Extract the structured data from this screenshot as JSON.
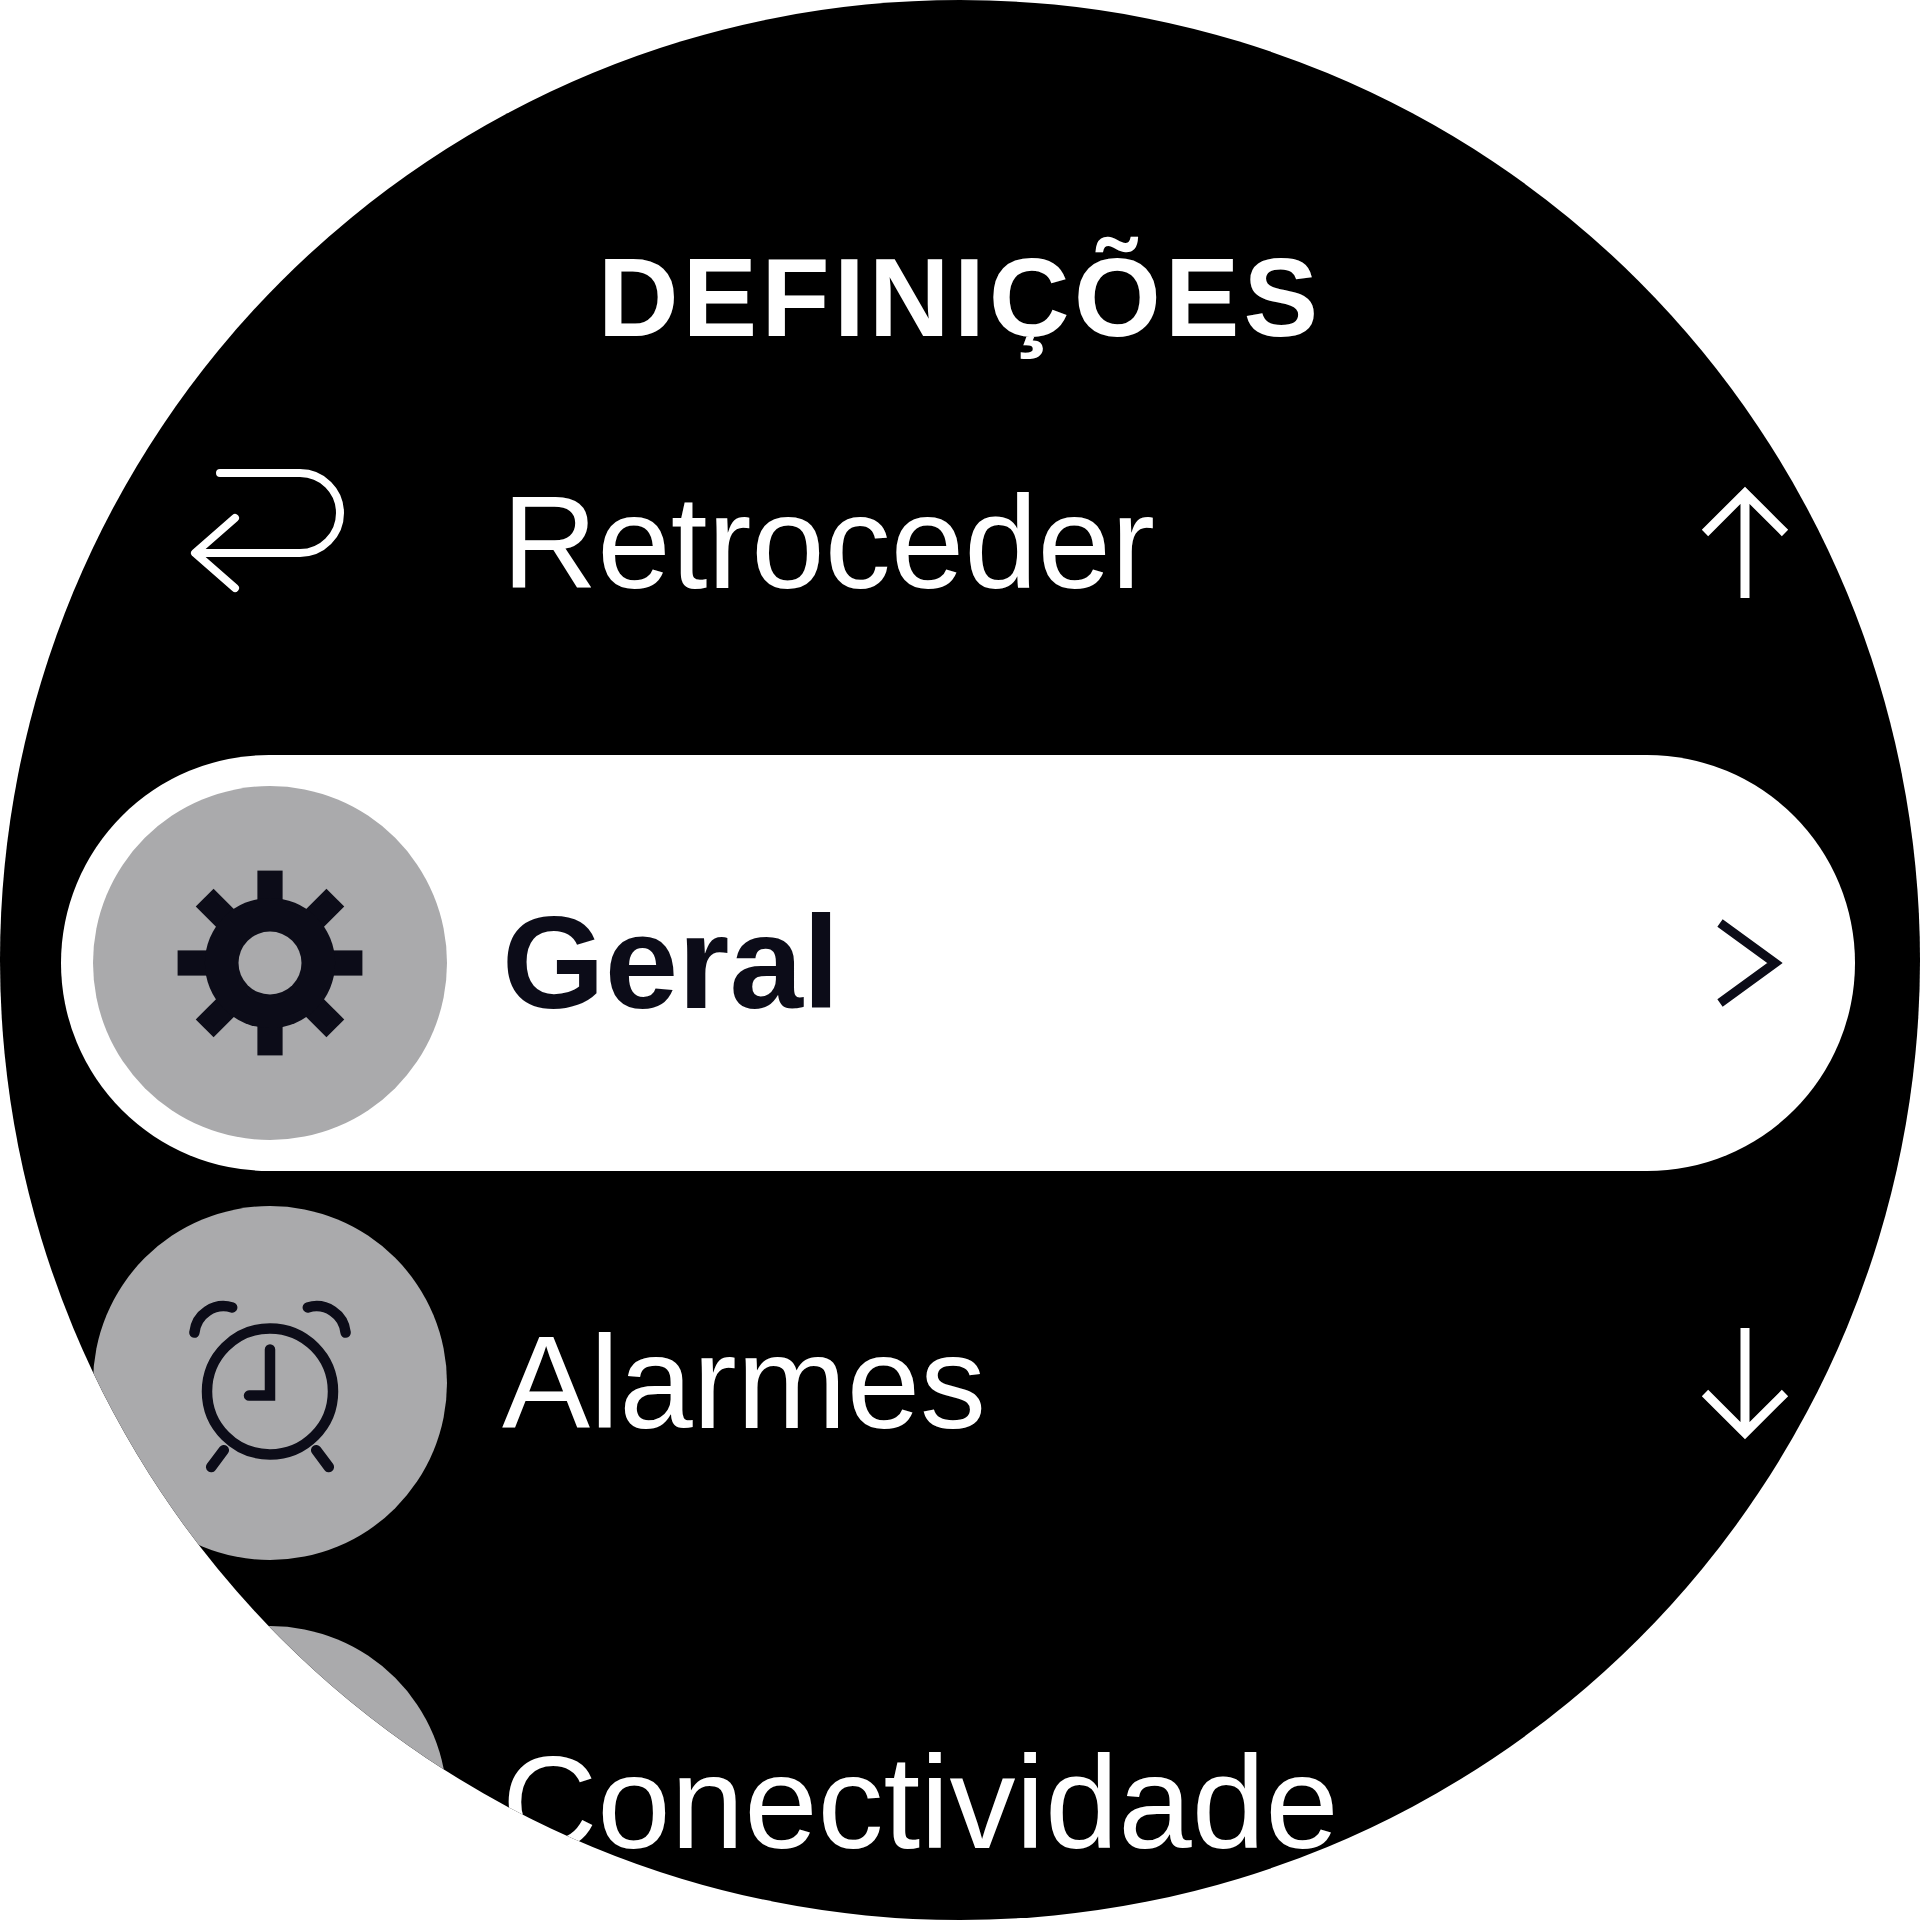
{
  "title": "DEFINIÇÕES",
  "items": [
    {
      "kind": "back",
      "label": "Retroceder",
      "selected": false,
      "trailing": {
        "kind": "up"
      }
    },
    {
      "kind": "gear",
      "label": "Geral",
      "selected": true,
      "trailing": {
        "kind": "chevron"
      }
    },
    {
      "kind": "alarm",
      "label": "Alarmes",
      "selected": false,
      "trailing": {
        "kind": "down"
      }
    },
    {
      "kind": "blank",
      "label": "Conectividade",
      "selected": false
    }
  ]
}
